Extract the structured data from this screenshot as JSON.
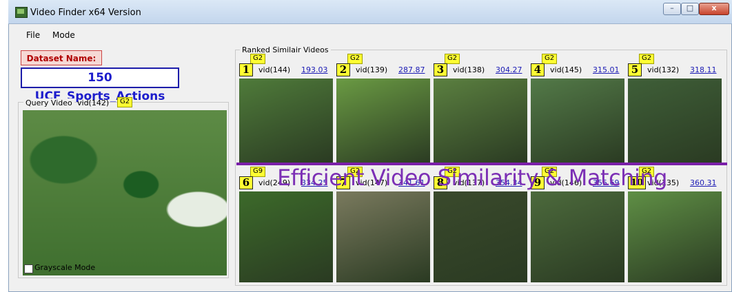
{
  "window": {
    "title": "Video Finder  x64 Version"
  },
  "window_controls": {
    "minimize": "–",
    "maximize": "□",
    "close": "x"
  },
  "menu": {
    "file": "File",
    "mode": "Mode"
  },
  "dataset": {
    "label": "Dataset Name:",
    "name": "150 UCF_Sports_Actions"
  },
  "query": {
    "label": "Query Video",
    "vid": "vid(142)",
    "group": "G2",
    "grayscale_label": "Grayscale Mode",
    "grayscale_checked": false
  },
  "ranked": {
    "label": "Ranked Similair Videos",
    "results": [
      {
        "rank": "1",
        "group": "G2",
        "vid": "vid(144)",
        "score": "193.03",
        "thumb_color": "#4f7b3a"
      },
      {
        "rank": "2",
        "group": "G2",
        "vid": "vid(139)",
        "score": "287.87",
        "thumb_color": "#6a9a43"
      },
      {
        "rank": "3",
        "group": "G2",
        "vid": "vid(138)",
        "score": "304.27",
        "thumb_color": "#5b8040"
      },
      {
        "rank": "4",
        "group": "G2",
        "vid": "vid(145)",
        "score": "315.01",
        "thumb_color": "#537a48"
      },
      {
        "rank": "5",
        "group": "G2",
        "vid": "vid(132)",
        "score": "318.11",
        "thumb_color": "#3f5f38"
      },
      {
        "rank": "6",
        "group": "G9",
        "vid": "vid(249)",
        "score": "334.25",
        "thumb_color": "#3c6a2a"
      },
      {
        "rank": "7",
        "group": "G2",
        "vid": "vid(147)",
        "score": "341.61",
        "thumb_color": "#7a7a5e"
      },
      {
        "rank": "8",
        "group": "G2",
        "vid": "vid(137)",
        "score": "354.34",
        "thumb_color": "#3a4a2c"
      },
      {
        "rank": "9",
        "group": "G2",
        "vid": "vid(146)",
        "score": "355.69",
        "thumb_color": "#4c6a3c"
      },
      {
        "rank": "10",
        "group": "G2",
        "vid": "vid(135)",
        "score": "360.31",
        "thumb_color": "#5f8f45"
      }
    ]
  },
  "overlay": {
    "caption": "Efficient Video Similarity & Matching"
  }
}
